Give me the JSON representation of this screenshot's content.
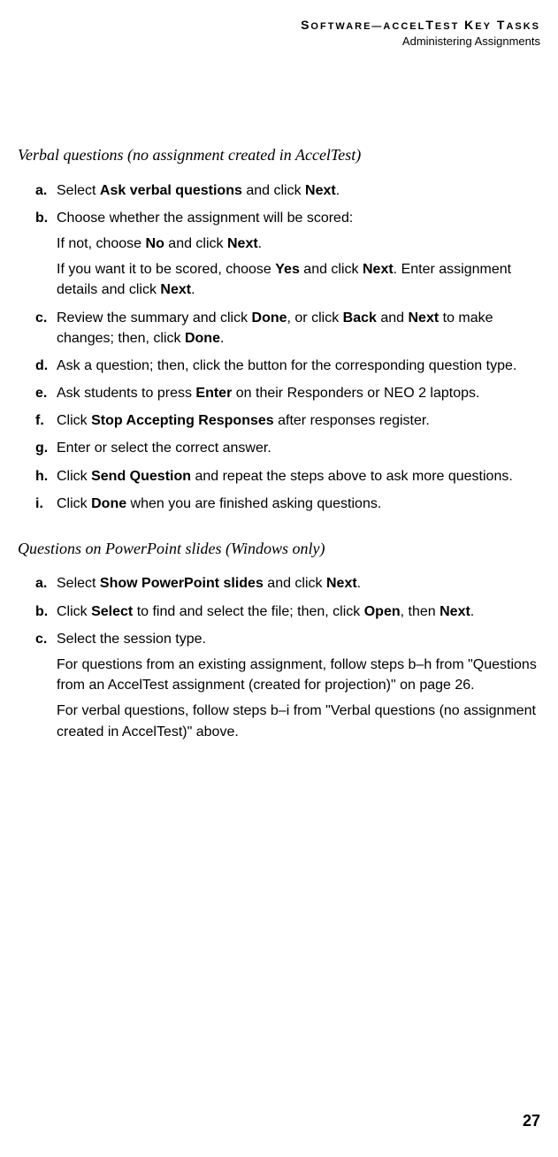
{
  "header": {
    "title_parts": [
      "S",
      "OFTWARE",
      "—A",
      "CCEL",
      "T",
      "EST",
      " K",
      "EY",
      " T",
      "ASKS"
    ],
    "subtitle": "Administering Assignments"
  },
  "sections": [
    {
      "heading": "Verbal questions (no assignment created in AccelTest)",
      "items": [
        {
          "marker": "a.",
          "paras": [
            [
              {
                "t": "Select "
              },
              {
                "t": "Ask verbal questions",
                "b": true
              },
              {
                "t": " and click "
              },
              {
                "t": "Next",
                "b": true
              },
              {
                "t": "."
              }
            ]
          ]
        },
        {
          "marker": "b.",
          "paras": [
            [
              {
                "t": "Choose whether the assignment will be scored:"
              }
            ],
            [
              {
                "t": "If not, choose "
              },
              {
                "t": "No",
                "b": true
              },
              {
                "t": " and click "
              },
              {
                "t": "Next",
                "b": true
              },
              {
                "t": "."
              }
            ],
            [
              {
                "t": "If you want it to be scored, choose "
              },
              {
                "t": "Yes",
                "b": true
              },
              {
                "t": " and click "
              },
              {
                "t": "Next",
                "b": true
              },
              {
                "t": ". Enter assignment details and click "
              },
              {
                "t": "Next",
                "b": true
              },
              {
                "t": "."
              }
            ]
          ]
        },
        {
          "marker": "c.",
          "paras": [
            [
              {
                "t": "Review the summary and click "
              },
              {
                "t": "Done",
                "b": true
              },
              {
                "t": ", or click "
              },
              {
                "t": "Back",
                "b": true
              },
              {
                "t": " and "
              },
              {
                "t": "Next",
                "b": true
              },
              {
                "t": " to make changes; then, click "
              },
              {
                "t": "Done",
                "b": true
              },
              {
                "t": "."
              }
            ]
          ]
        },
        {
          "marker": "d.",
          "paras": [
            [
              {
                "t": "Ask a question; then, click the button for the corresponding question type."
              }
            ]
          ]
        },
        {
          "marker": "e.",
          "paras": [
            [
              {
                "t": "Ask students to press "
              },
              {
                "t": "Enter",
                "b": true
              },
              {
                "t": " on their Responders or NEO 2 laptops."
              }
            ]
          ]
        },
        {
          "marker": "f.",
          "paras": [
            [
              {
                "t": "Click "
              },
              {
                "t": "Stop Accepting Responses",
                "b": true
              },
              {
                "t": " after responses register."
              }
            ]
          ]
        },
        {
          "marker": "g.",
          "paras": [
            [
              {
                "t": "Enter or select the correct answer."
              }
            ]
          ]
        },
        {
          "marker": "h.",
          "paras": [
            [
              {
                "t": "Click "
              },
              {
                "t": "Send Question",
                "b": true
              },
              {
                "t": " and repeat the steps above to ask more questions."
              }
            ]
          ]
        },
        {
          "marker": "i.",
          "paras": [
            [
              {
                "t": "Click "
              },
              {
                "t": "Done",
                "b": true
              },
              {
                "t": " when you are finished asking questions."
              }
            ]
          ]
        }
      ]
    },
    {
      "heading": "Questions on PowerPoint slides (Windows only)",
      "items": [
        {
          "marker": "a.",
          "paras": [
            [
              {
                "t": "Select "
              },
              {
                "t": "Show PowerPoint slides",
                "b": true
              },
              {
                "t": " and click "
              },
              {
                "t": "Next",
                "b": true
              },
              {
                "t": "."
              }
            ]
          ]
        },
        {
          "marker": "b.",
          "paras": [
            [
              {
                "t": "Click "
              },
              {
                "t": "Select",
                "b": true
              },
              {
                "t": " to find and select the file; then, click "
              },
              {
                "t": "Open",
                "b": true
              },
              {
                "t": ", then "
              },
              {
                "t": "Next",
                "b": true
              },
              {
                "t": "."
              }
            ]
          ]
        },
        {
          "marker": "c.",
          "paras": [
            [
              {
                "t": "Select the session type."
              }
            ],
            [
              {
                "t": "For questions from an existing assignment, follow steps b–h from \"Questions from an AccelTest assignment (created for projection)\" on page 26."
              }
            ],
            [
              {
                "t": "For verbal questions, follow steps b–i from \"Verbal questions (no assignment created in AccelTest)\" above."
              }
            ]
          ]
        }
      ]
    }
  ],
  "page_number": "27"
}
